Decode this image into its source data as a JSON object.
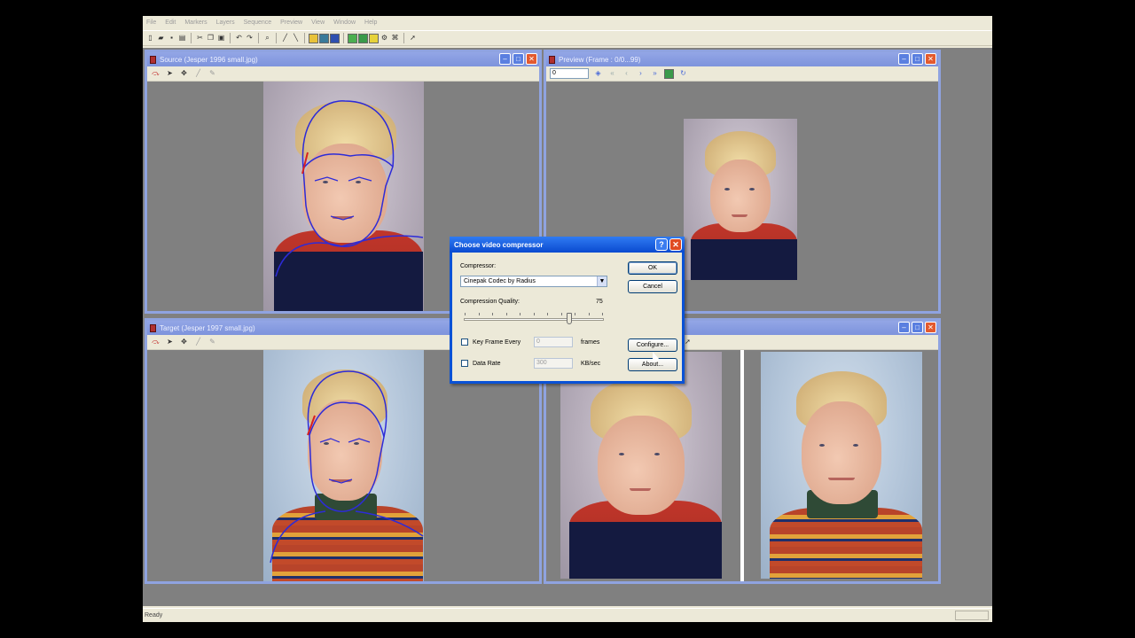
{
  "app": {
    "menu": [
      "File",
      "Edit",
      "Markers",
      "Layers",
      "Sequence",
      "Preview",
      "View",
      "Window",
      "Help"
    ],
    "status_text": "Ready"
  },
  "windows": {
    "source": {
      "title": "Source (Jesper 1996 small.jpg)"
    },
    "target": {
      "title": "Target (Jesper 1997 small.jpg)"
    },
    "preview": {
      "title": "Preview (Frame : 0/0...99)",
      "frame_value": "0"
    }
  },
  "dialog": {
    "title": "Choose video compressor",
    "help_glyph": "?",
    "close_glyph": "✕",
    "compressor_label": "Compressor:",
    "compressor_value": "Cinepak Codec by Radius",
    "quality_label": "Compression Quality:",
    "quality_value": "75",
    "quality_fraction": 0.75,
    "keyframe_label": "Key Frame Every",
    "keyframe_value": "0",
    "keyframe_unit": "frames",
    "datarate_label": "Data Rate",
    "datarate_value": "300",
    "datarate_unit": "KB/sec",
    "ok_label": "OK",
    "cancel_label": "Cancel",
    "configure_label": "Configure...",
    "about_label": "About..."
  },
  "colors": {
    "mdi_caption": "#8fa3e0",
    "dialog_caption": "#0a52d6",
    "workspace": "#808080"
  }
}
